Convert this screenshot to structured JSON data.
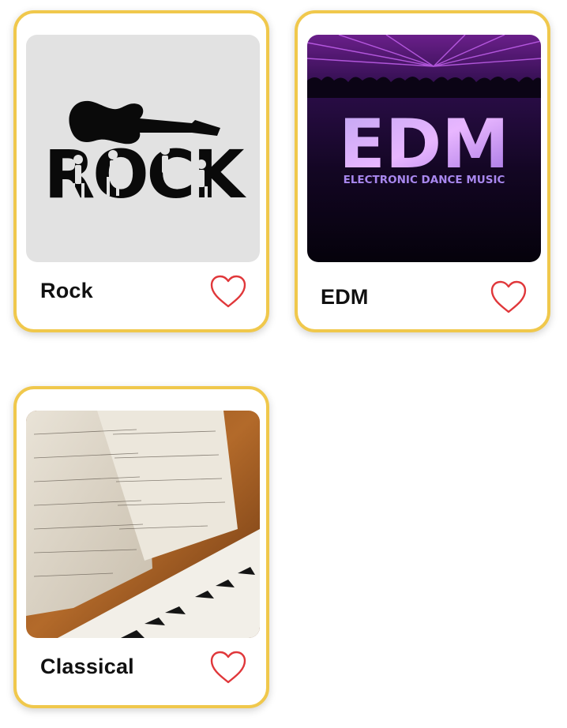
{
  "genres": [
    {
      "name": "Rock",
      "art_text": "ROCK",
      "favorited": false
    },
    {
      "name": "EDM",
      "art_text": "EDM",
      "art_subtext": "ELECTRONIC DANCE MUSIC",
      "favorited": false
    },
    {
      "name": "Classical",
      "favorited": false
    }
  ],
  "colors": {
    "card_border": "#f0c84c",
    "heart": "#e0373a",
    "title": "#111111"
  },
  "icons": {
    "favorite": "heart-outline-icon"
  }
}
